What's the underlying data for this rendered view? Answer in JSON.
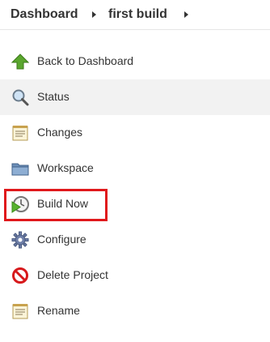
{
  "breadcrumb": {
    "items": [
      {
        "label": "Dashboard"
      },
      {
        "label": "first build"
      }
    ]
  },
  "tasks": [
    {
      "label": "Back to Dashboard",
      "icon": "up-arrow-icon"
    },
    {
      "label": "Status",
      "icon": "magnifier-icon",
      "active": true
    },
    {
      "label": "Changes",
      "icon": "notepad-icon"
    },
    {
      "label": "Workspace",
      "icon": "folder-icon"
    },
    {
      "label": "Build Now",
      "icon": "clock-play-icon",
      "highlighted": true
    },
    {
      "label": "Configure",
      "icon": "gear-icon"
    },
    {
      "label": "Delete Project",
      "icon": "no-entry-icon"
    },
    {
      "label": "Rename",
      "icon": "notepad-icon"
    }
  ],
  "colors": {
    "highlight": "#e0191c",
    "active_row": "#f2f2f2",
    "text": "#333333"
  }
}
